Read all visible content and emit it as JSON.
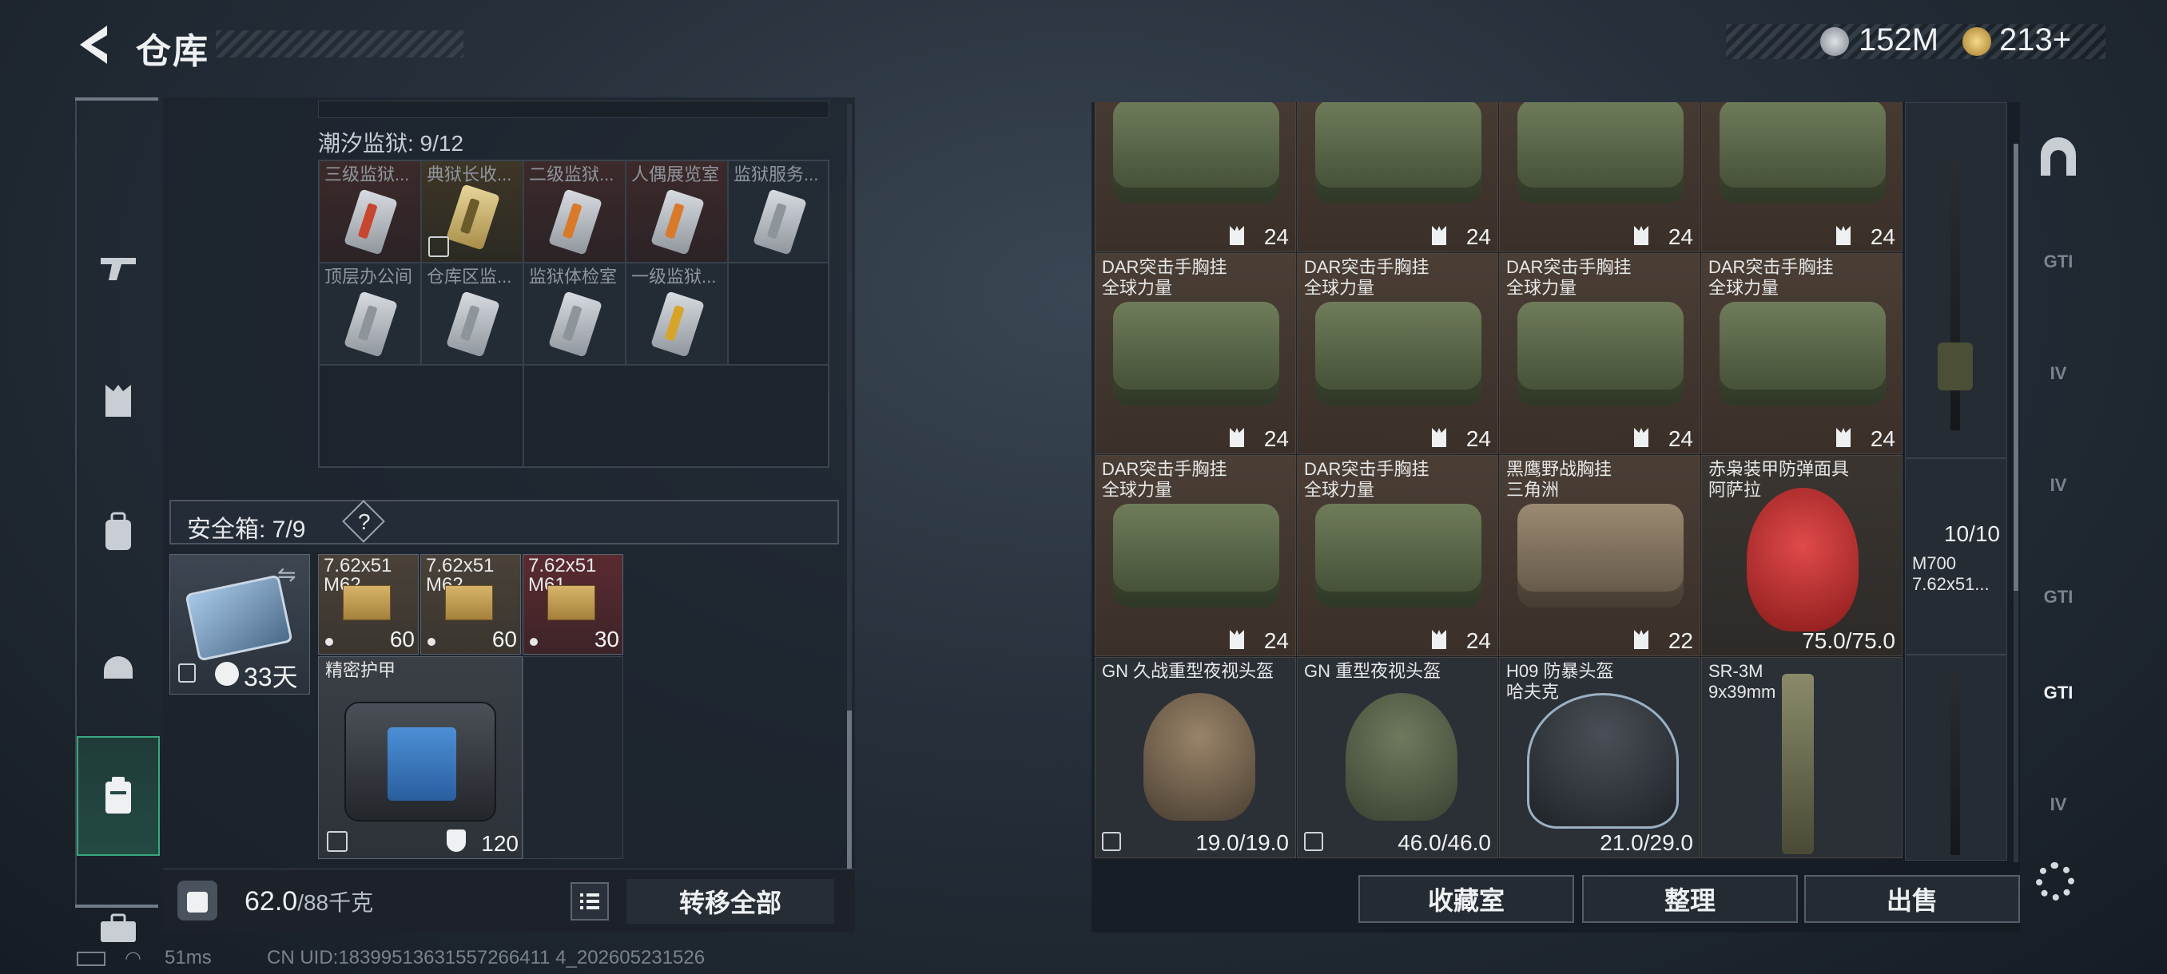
{
  "header": {
    "title": "仓库",
    "currency1": "152M",
    "currency2": "213+"
  },
  "left_nav": [
    "weapon",
    "armor-vest",
    "backpack",
    "helmet",
    "locker",
    "toolbox"
  ],
  "prison_section": {
    "title": "潮汐监狱: 9/12",
    "cells": [
      {
        "label": "三级监狱...",
        "style": "red",
        "card": "red"
      },
      {
        "label": "典狱长收...",
        "style": "gold",
        "card": "gold",
        "lock": true
      },
      {
        "label": "二级监狱...",
        "style": "red",
        "card": "orange"
      },
      {
        "label": "人偶展览室",
        "style": "red",
        "card": "orange"
      },
      {
        "label": "监狱服务...",
        "style": "plain",
        "card": "gray"
      },
      {
        "label": "顶层办公间",
        "style": "plain",
        "card": "gray"
      },
      {
        "label": "仓库区监...",
        "style": "plain",
        "card": "gray"
      },
      {
        "label": "监狱体检室",
        "style": "plain",
        "card": "gray"
      },
      {
        "label": "一级监狱...",
        "style": "plain",
        "card": "gold"
      }
    ]
  },
  "safe": {
    "title": "安全箱: 7/9",
    "help": "?",
    "days": "33天",
    "ammo": [
      {
        "name1": "7.62x51",
        "name2": "M62",
        "count": "60",
        "style": "n"
      },
      {
        "name1": "7.62x51",
        "name2": "M62",
        "count": "60",
        "style": "n"
      },
      {
        "name1": "7.62x51",
        "name2": "M61",
        "count": "30",
        "style": "r"
      }
    ],
    "armor": {
      "name": "精密护甲",
      "value": "120"
    }
  },
  "footer": {
    "weight": "62.0",
    "weight_max": "/88千克",
    "transfer": "转移全部"
  },
  "right_items": [
    {
      "name1": "",
      "name2": "",
      "value": "24",
      "type": "bag"
    },
    {
      "name1": "",
      "name2": "",
      "value": "24",
      "type": "bag"
    },
    {
      "name1": "",
      "name2": "",
      "value": "24",
      "type": "bag"
    },
    {
      "name1": "",
      "name2": "",
      "value": "24",
      "type": "bag"
    },
    {
      "name1": "DAR突击手胸挂",
      "name2": "全球力量",
      "value": "24",
      "type": "bag"
    },
    {
      "name1": "DAR突击手胸挂",
      "name2": "全球力量",
      "value": "24",
      "type": "bag"
    },
    {
      "name1": "DAR突击手胸挂",
      "name2": "全球力量",
      "value": "24",
      "type": "bag"
    },
    {
      "name1": "DAR突击手胸挂",
      "name2": "全球力量",
      "value": "24",
      "type": "bag"
    },
    {
      "name1": "DAR突击手胸挂",
      "name2": "全球力量",
      "value": "24",
      "type": "bag"
    },
    {
      "name1": "DAR突击手胸挂",
      "name2": "全球力量",
      "value": "24",
      "type": "bag"
    },
    {
      "name1": "黑鹰野战胸挂",
      "name2": "三角洲",
      "value": "22",
      "type": "bag2"
    },
    {
      "name1": "赤枭装甲防弹面具",
      "name2": "阿萨拉",
      "value": "75.0/75.0",
      "type": "mask"
    },
    {
      "name1": "GN 久战重型夜视头盔",
      "name2": "",
      "value": "19.0/19.0",
      "type": "nvg"
    },
    {
      "name1": "GN 重型夜视头盔",
      "name2": "",
      "value": "46.0/46.0",
      "type": "nvg2"
    },
    {
      "name1": "H09 防暴头盔",
      "name2": "哈夫克",
      "value": "21.0/29.0",
      "type": "riot"
    },
    {
      "name1": "SR-3M",
      "name2": "9x39mm",
      "value": "",
      "type": "rifle"
    }
  ],
  "sniper": {
    "count": "10/10",
    "name1": "M700",
    "name2": "7.62x51..."
  },
  "right_tabs": [
    "GTI",
    "IV",
    "IV",
    "GTI",
    "GTI",
    "IV"
  ],
  "buttons": {
    "collection": "收藏室",
    "organize": "整理",
    "sell": "出售"
  },
  "status": {
    "ping": "51ms",
    "uid": "CN UID:18399513631557266411 4_202605231526"
  }
}
